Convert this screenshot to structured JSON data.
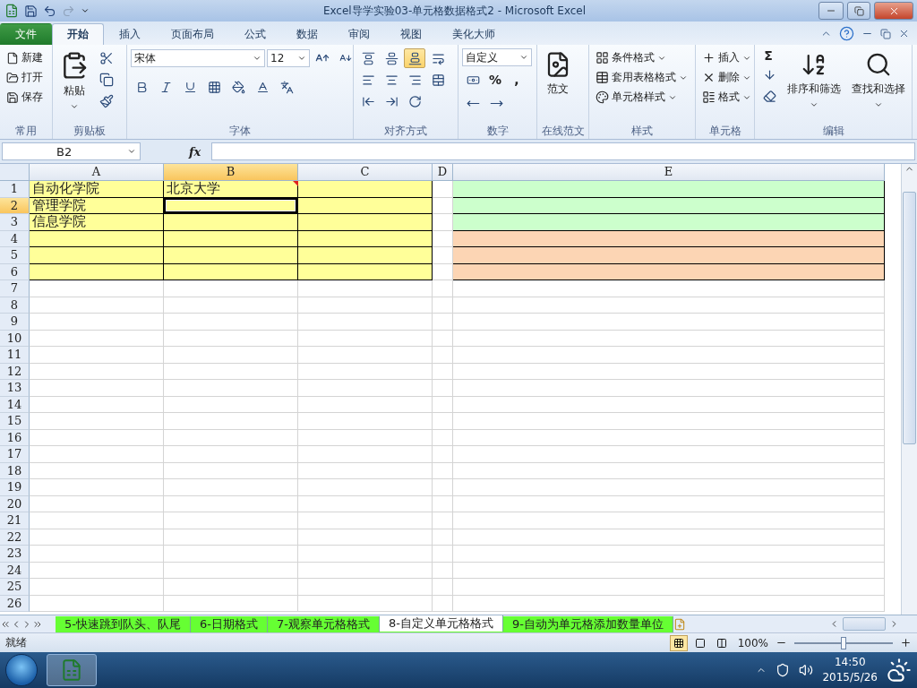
{
  "window": {
    "title": "Excel导学实验03-单元格数据格式2 - Microsoft Excel"
  },
  "ribbon": {
    "tabs": [
      {
        "label": "文件",
        "kind": "file",
        "selected": false
      },
      {
        "label": "开始",
        "kind": "tab",
        "selected": true
      },
      {
        "label": "插入",
        "kind": "tab",
        "selected": false
      },
      {
        "label": "页面布局",
        "kind": "tab",
        "selected": false
      },
      {
        "label": "公式",
        "kind": "tab",
        "selected": false
      },
      {
        "label": "数据",
        "kind": "tab",
        "selected": false
      },
      {
        "label": "审阅",
        "kind": "tab",
        "selected": false
      },
      {
        "label": "视图",
        "kind": "tab",
        "selected": false
      },
      {
        "label": "美化大师",
        "kind": "tab",
        "selected": false
      }
    ],
    "groups": [
      {
        "kind": "common",
        "label": "常用",
        "buttons": [
          "新建",
          "打开",
          "保存"
        ]
      },
      {
        "kind": "clipboard",
        "label": "剪贴板",
        "buttons": [
          "粘贴"
        ]
      },
      {
        "kind": "font",
        "label": "字体",
        "font": "宋体",
        "size": "12"
      },
      {
        "kind": "align",
        "label": "对齐方式",
        "vertical_align": [
          {
            "selected": false
          },
          {
            "selected": false
          },
          {
            "selected": true
          }
        ]
      },
      {
        "kind": "number",
        "label": "数字",
        "format": "自定义",
        "symbols": [
          "%",
          ","
        ]
      },
      {
        "kind": "online",
        "label": "在线范文",
        "buttons": [
          "范文"
        ]
      },
      {
        "kind": "styles",
        "label": "样式",
        "buttons": [
          "条件格式",
          "套用表格格式",
          "单元格样式"
        ]
      },
      {
        "kind": "cells",
        "label": "单元格",
        "buttons": [
          "插入",
          "删除",
          "格式"
        ]
      },
      {
        "kind": "editing",
        "label": "编辑",
        "symbols": [
          "Σ"
        ],
        "buttons": [
          "排序和筛选",
          "查找和选择"
        ]
      }
    ]
  },
  "formula_bar": {
    "name_box": "B2",
    "function_label": "fx"
  },
  "sheet": {
    "columns": [
      {
        "label": "A",
        "selected": false
      },
      {
        "label": "B",
        "selected": true
      },
      {
        "label": "C",
        "selected": false
      },
      {
        "label": "D",
        "selected": false
      },
      {
        "label": "E",
        "selected": false
      }
    ],
    "rows": [
      {
        "label": "1",
        "selected": false,
        "cells": [
          {
            "text": "自动化学院",
            "color": "#ffff99",
            "selected": false,
            "comment": false
          },
          {
            "text": "北京大学",
            "color": "#ffff99",
            "selected": false,
            "comment": true
          },
          {
            "text": "",
            "color": "#ffff99",
            "selected": false,
            "comment": false
          },
          {
            "text": "",
            "color": "#ffffff",
            "selected": false,
            "comment": false
          },
          {
            "text": "",
            "color": "#ccffcc",
            "selected": false,
            "comment": false
          }
        ]
      },
      {
        "label": "2",
        "selected": true,
        "cells": [
          {
            "text": "管理学院",
            "color": "#ffff99",
            "selected": false,
            "comment": false
          },
          {
            "text": "",
            "color": "#ffff99",
            "selected": true,
            "comment": false
          },
          {
            "text": "",
            "color": "#ffff99",
            "selected": false,
            "comment": false
          },
          {
            "text": "",
            "color": "#ffffff",
            "selected": false,
            "comment": false
          },
          {
            "text": "",
            "color": "#ccffcc",
            "selected": false,
            "comment": false
          }
        ]
      },
      {
        "label": "3",
        "selected": false,
        "cells": [
          {
            "text": "信息学院",
            "color": "#ffff99",
            "selected": false,
            "comment": false
          },
          {
            "text": "",
            "color": "#ffff99",
            "selected": false,
            "comment": false
          },
          {
            "text": "",
            "color": "#ffff99",
            "selected": false,
            "comment": false
          },
          {
            "text": "",
            "color": "#ffffff",
            "selected": false,
            "comment": false
          },
          {
            "text": "",
            "color": "#ccffcc",
            "selected": false,
            "comment": false
          }
        ]
      },
      {
        "label": "4",
        "selected": false,
        "cells": [
          {
            "text": "",
            "color": "#ffff99",
            "selected": false,
            "comment": false
          },
          {
            "text": "",
            "color": "#ffff99",
            "selected": false,
            "comment": false
          },
          {
            "text": "",
            "color": "#ffff99",
            "selected": false,
            "comment": false
          },
          {
            "text": "",
            "color": "#ffffff",
            "selected": false,
            "comment": false
          },
          {
            "text": "",
            "color": "#fcd5b4",
            "selected": false,
            "comment": false
          }
        ]
      },
      {
        "label": "5",
        "selected": false,
        "cells": [
          {
            "text": "",
            "color": "#ffff99",
            "selected": false,
            "comment": false
          },
          {
            "text": "",
            "color": "#ffff99",
            "selected": false,
            "comment": false
          },
          {
            "text": "",
            "color": "#ffff99",
            "selected": false,
            "comment": false
          },
          {
            "text": "",
            "color": "#ffffff",
            "selected": false,
            "comment": false
          },
          {
            "text": "",
            "color": "#fcd5b4",
            "selected": false,
            "comment": false
          }
        ]
      },
      {
        "label": "6",
        "selected": false,
        "cells": [
          {
            "text": "",
            "color": "#ffff99",
            "selected": false,
            "comment": false
          },
          {
            "text": "",
            "color": "#ffff99",
            "selected": false,
            "comment": false
          },
          {
            "text": "",
            "color": "#ffff99",
            "selected": false,
            "comment": false
          },
          {
            "text": "",
            "color": "#ffffff",
            "selected": false,
            "comment": false
          },
          {
            "text": "",
            "color": "#fcd5b4",
            "selected": false,
            "comment": false
          }
        ]
      },
      {
        "label": "7",
        "selected": false
      },
      {
        "label": "8",
        "selected": false
      },
      {
        "label": "9",
        "selected": false
      },
      {
        "label": "10",
        "selected": false
      },
      {
        "label": "11",
        "selected": false
      },
      {
        "label": "12",
        "selected": false
      },
      {
        "label": "13",
        "selected": false
      },
      {
        "label": "14",
        "selected": false
      },
      {
        "label": "15",
        "selected": false
      },
      {
        "label": "16",
        "selected": false
      },
      {
        "label": "17",
        "selected": false
      },
      {
        "label": "18",
        "selected": false
      },
      {
        "label": "19",
        "selected": false
      },
      {
        "label": "20",
        "selected": false
      },
      {
        "label": "21",
        "selected": false
      },
      {
        "label": "22",
        "selected": false
      },
      {
        "label": "23",
        "selected": false
      },
      {
        "label": "24",
        "selected": false
      },
      {
        "label": "25",
        "selected": false
      },
      {
        "label": "26",
        "selected": false
      }
    ]
  },
  "sheet_tabs": [
    {
      "label": "5-快速跳到队头、队尾",
      "selected": false,
      "color": "#66ff33"
    },
    {
      "label": "6-日期格式",
      "selected": false,
      "color": "#66ff33"
    },
    {
      "label": "7-观察单元格格式",
      "selected": false,
      "color": "#66ff33"
    },
    {
      "label": "8-自定义单元格格式",
      "selected": true,
      "color": "#66ff33"
    },
    {
      "label": "9-自动为单元格添加数量单位",
      "selected": false,
      "color": "#66ff33"
    }
  ],
  "status_bar": {
    "status": "就绪",
    "views": [
      {
        "selected": true
      },
      {
        "selected": false
      },
      {
        "selected": false
      }
    ],
    "zoom": "100%",
    "level": 0.5
  },
  "taskbar": {
    "time": "14:50",
    "date": "2015/5/26"
  }
}
